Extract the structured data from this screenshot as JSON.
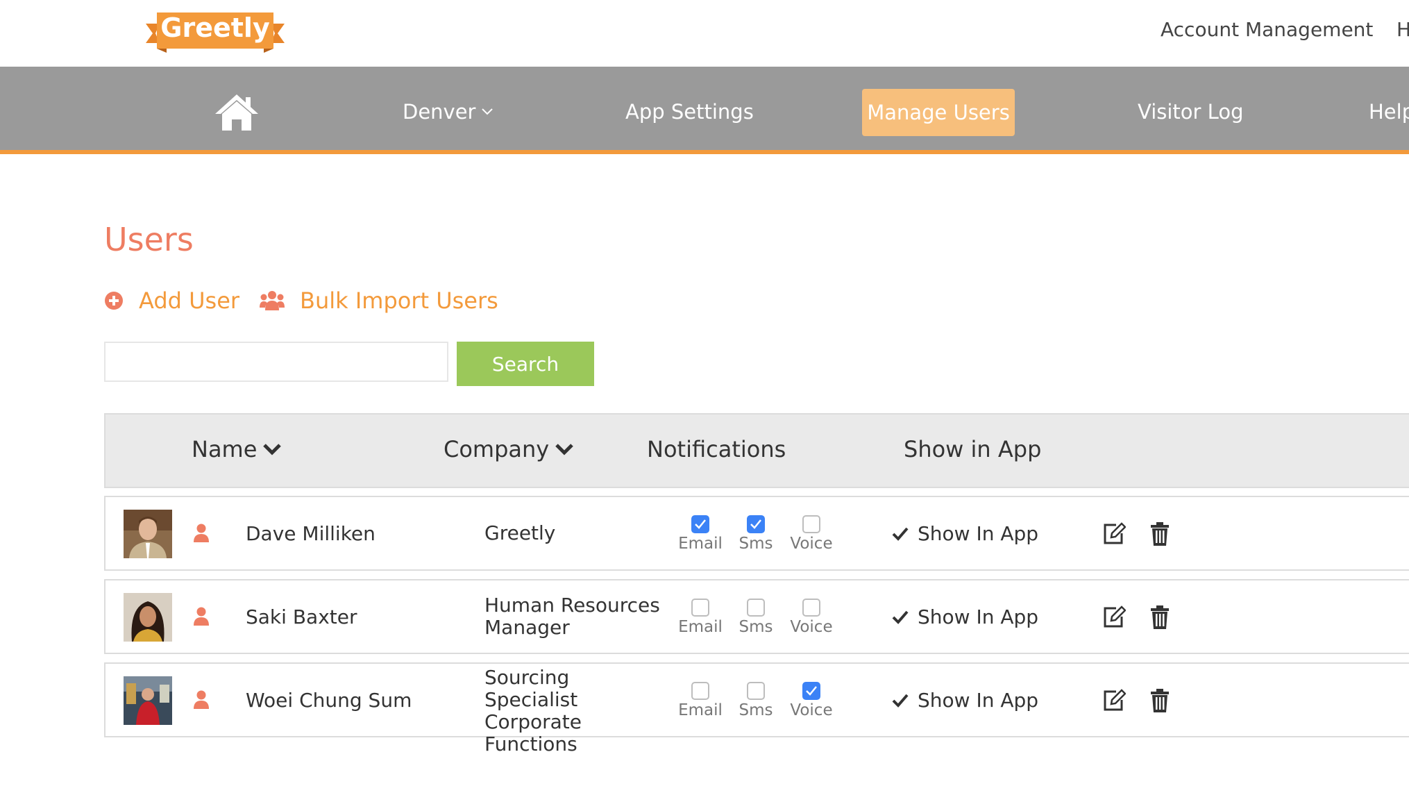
{
  "brand": {
    "logo_text": "Greetly"
  },
  "top_links": {
    "account": "Account Management",
    "partial": "H"
  },
  "nav": {
    "home_icon": "home-icon",
    "location": "Denver",
    "app_settings": "App Settings",
    "manage_users": "Manage Users",
    "visitor_log": "Visitor Log",
    "help": "Help"
  },
  "page": {
    "title": "Users",
    "add_user": "Add User",
    "bulk_import": "Bulk Import Users"
  },
  "search": {
    "value": "",
    "button": "Search"
  },
  "table": {
    "headers": {
      "name": "Name",
      "company": "Company",
      "notifications": "Notifications",
      "show_in_app": "Show in App"
    },
    "notif_labels": {
      "email": "Email",
      "sms": "Sms",
      "voice": "Voice"
    },
    "rows": [
      {
        "name": "Dave Milliken",
        "company_lines": [
          "Greetly"
        ],
        "email": true,
        "sms": true,
        "voice": false,
        "show_in_app": "Show In App"
      },
      {
        "name": "Saki Baxter",
        "company_lines": [
          "Human Resources",
          "Manager"
        ],
        "email": false,
        "sms": false,
        "voice": false,
        "show_in_app": "Show In App"
      },
      {
        "name": "Woei Chung Sum",
        "company_lines": [
          "Sourcing Specialist",
          "Corporate",
          "Functions"
        ],
        "email": false,
        "sms": false,
        "voice": true,
        "show_in_app": "Show In App"
      }
    ]
  },
  "colors": {
    "accent": "#f39a3b",
    "title": "#ee7d62",
    "nav_bg": "#9a9a9a",
    "nav_active": "#f7bf7c",
    "search_btn": "#9bc85a",
    "checkbox_on": "#3b82f6"
  }
}
